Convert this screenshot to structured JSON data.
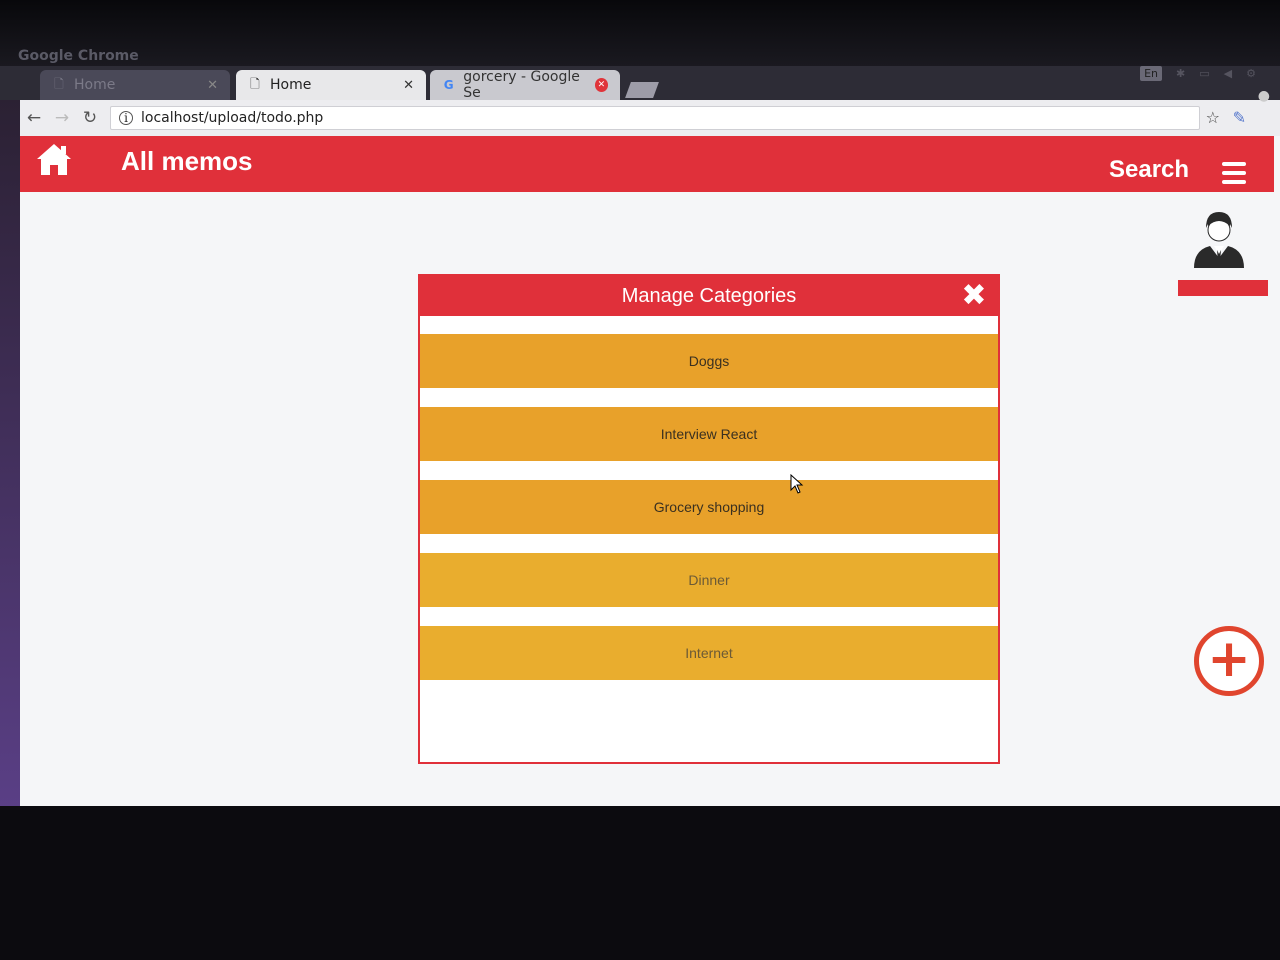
{
  "window": {
    "title": "Google Chrome"
  },
  "tabs": [
    {
      "title": "Home",
      "icon": "page-icon"
    },
    {
      "title": "Home",
      "icon": "page-icon"
    },
    {
      "title": "gorcery - Google Se",
      "icon": "google-icon"
    }
  ],
  "tray": {
    "lang": "En"
  },
  "browser": {
    "url": "localhost/upload/todo.php"
  },
  "appbar": {
    "title": "All memos",
    "search_label": "Search"
  },
  "modal": {
    "title": "Manage Categories",
    "close_glyph": "✖",
    "categories": [
      "Doggs",
      "Interview React",
      "Grocery shopping",
      "Dinner",
      "Internet"
    ]
  },
  "fab": {
    "glyph": "+"
  },
  "colors": {
    "primary": "#e0303a",
    "category": "#e8a12a",
    "fab": "#e0452e"
  }
}
